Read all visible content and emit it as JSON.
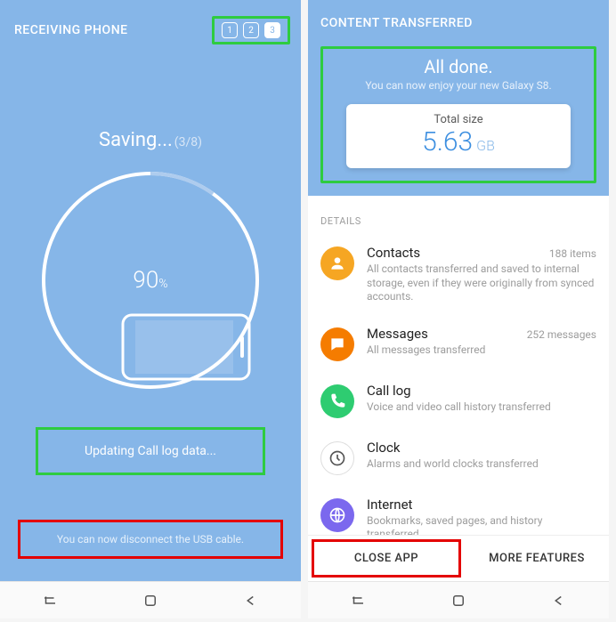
{
  "left": {
    "header_title": "RECEIVING PHONE",
    "steps": [
      "1",
      "2",
      "3"
    ],
    "active_step_index": 2,
    "saving_label": "Saving...",
    "saving_progress_text": "(3/8)",
    "ring_percent": 90,
    "percent_display": "90",
    "percent_suffix": "%",
    "status_text": "Updating Call log data...",
    "disconnect_text": "You can now disconnect the USB cable."
  },
  "right": {
    "header_title": "CONTENT TRANSFERRED",
    "done_title": "All done.",
    "done_subtitle": "You can now enjoy your new Galaxy S8.",
    "total_size_label": "Total size",
    "total_size_value": "5.63",
    "total_size_unit": "GB",
    "details_label": "DETAILS",
    "items": [
      {
        "icon": "contacts-icon",
        "icon_bg": "#f6a623",
        "title": "Contacts",
        "meta": "188 items",
        "sub": "All contacts transferred and saved to internal storage, even if they were originally from synced accounts."
      },
      {
        "icon": "messages-icon",
        "icon_bg": "#f57c00",
        "title": "Messages",
        "meta": "252 messages",
        "sub": "All messages transferred"
      },
      {
        "icon": "call-log-icon",
        "icon_bg": "#2ecc71",
        "title": "Call log",
        "meta": "",
        "sub": "Voice and video call history transferred"
      },
      {
        "icon": "clock-icon",
        "icon_bg": "#ffffff",
        "title": "Clock",
        "meta": "",
        "sub": "Alarms and world clocks transferred"
      },
      {
        "icon": "internet-icon",
        "icon_bg": "#7b68ee",
        "title": "Internet",
        "meta": "",
        "sub": "Bookmarks, saved pages, and history transferred"
      }
    ],
    "close_label": "CLOSE APP",
    "more_label": "MORE FEATURES"
  },
  "colors": {
    "blue": "#86b6e8",
    "highlight_green": "#2ecc40",
    "highlight_red": "#e40000"
  }
}
